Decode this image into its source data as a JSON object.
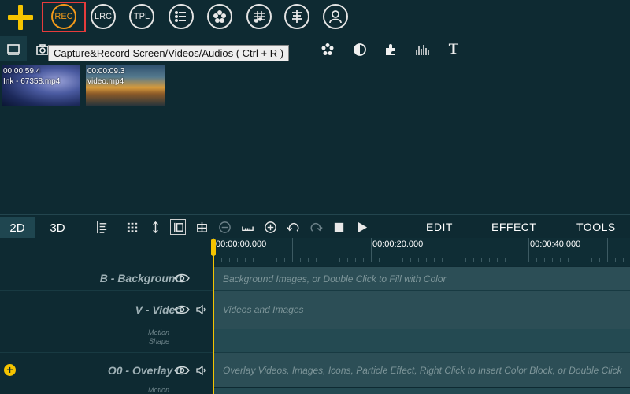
{
  "top_toolbar": {
    "buttons": [
      {
        "name": "add",
        "label": ""
      },
      {
        "name": "rec",
        "label": "REC"
      },
      {
        "name": "lrc",
        "label": "LRC"
      },
      {
        "name": "tpl",
        "label": "TPL"
      },
      {
        "name": "list",
        "icon": "list-icon"
      },
      {
        "name": "effects",
        "icon": "flower-icon"
      },
      {
        "name": "music",
        "icon": "music-notes-icon"
      },
      {
        "name": "subtitle",
        "icon": "subtitle-icon"
      },
      {
        "name": "account",
        "icon": "user-icon"
      }
    ]
  },
  "tooltip": {
    "text": "Capture&Record Screen/Videos/Audios ( Ctrl + R )"
  },
  "media": {
    "items": [
      {
        "duration": "00:00:59.4",
        "filename": "Ink - 67358.mp4"
      },
      {
        "duration": "00:00:09.3",
        "filename": "video.mp4"
      }
    ]
  },
  "timeline": {
    "tabs": [
      {
        "label": "2D",
        "active": true
      },
      {
        "label": "3D",
        "active": false
      }
    ],
    "menus": [
      "EDIT",
      "EFFECT",
      "TOOLS"
    ],
    "ruler_labels": [
      "00:00:00.000",
      "00:00:20.000",
      "00:00:40.000"
    ],
    "tracks": [
      {
        "name": "B - Background",
        "hint": "Background Images, or Double Click to Fill with Color"
      },
      {
        "name": "V - Video",
        "hint": "Videos and Images",
        "sub1": "Motion",
        "sub2": "Shape"
      },
      {
        "name": "O0 - Overlay 0",
        "hint": "Overlay Videos, Images, Icons, Particle Effect, Right Click to Insert Color Block, or Double Click",
        "sub1": "Motion"
      }
    ]
  },
  "colors": {
    "accent": "#f5c400",
    "rec": "#f29a1a",
    "background": "#0e2a32"
  }
}
